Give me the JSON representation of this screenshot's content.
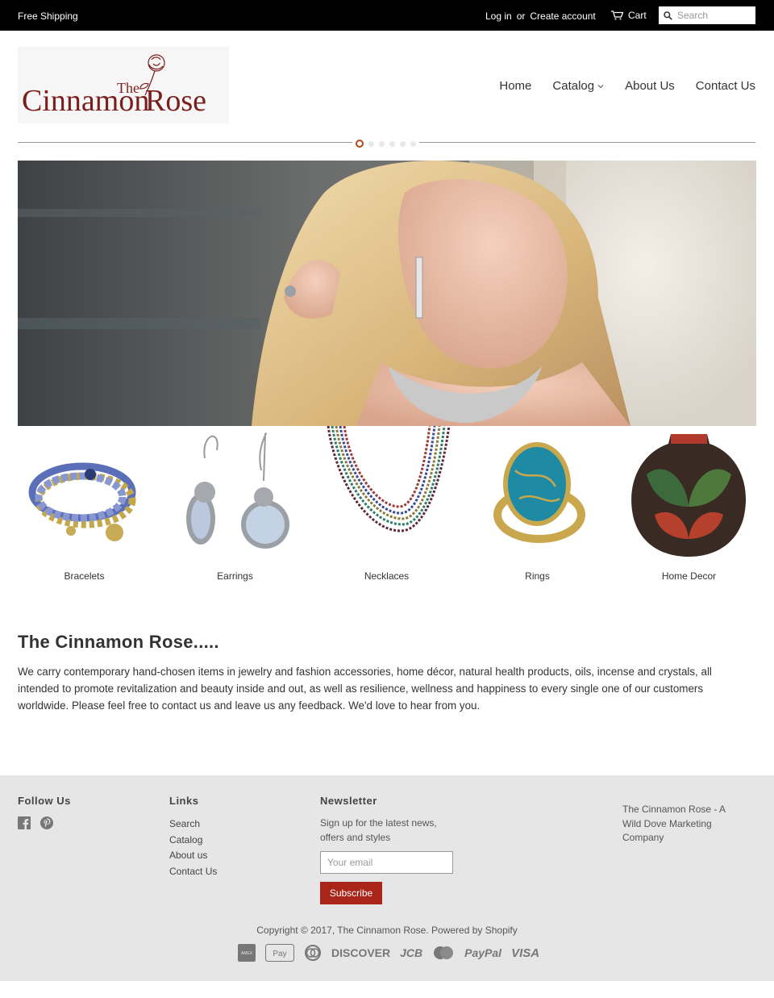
{
  "topbar": {
    "shipping": "Free Shipping",
    "login": "Log in",
    "or": "or",
    "create_account": "Create account",
    "cart": "Cart",
    "search_placeholder": "Search"
  },
  "logo": {
    "text": "The Cinnamon Rose",
    "the": "The",
    "cinnamon": "Cinnamon",
    "rose": "Rose"
  },
  "nav": {
    "home": "Home",
    "catalog": "Catalog",
    "about": "About Us",
    "contact": "Contact Us"
  },
  "slider": {
    "slide_count": 6,
    "active_slide": 1
  },
  "categories": [
    {
      "label": "Bracelets",
      "icon": "bracelet-image"
    },
    {
      "label": "Earrings",
      "icon": "earrings-image"
    },
    {
      "label": "Necklaces",
      "icon": "necklace-image"
    },
    {
      "label": "Rings",
      "icon": "ring-image"
    },
    {
      "label": "Home Decor",
      "icon": "vase-image"
    }
  ],
  "about": {
    "title": "The Cinnamon Rose.....",
    "text": "We carry contemporary hand-chosen items in jewelry and fashion accessories, home décor, natural health products, oils, incense and crystals, all intended to promote revitalization and beauty inside and out, as well as resilience, wellness and happiness to every single one of our customers worldwide. Please feel free to contact us and leave us any feedback. We'd love to hear from you."
  },
  "footer": {
    "follow_title": "Follow Us",
    "links_title": "Links",
    "links": [
      "Search",
      "Catalog",
      "About us",
      "Contact Us"
    ],
    "newsletter_title": "Newsletter",
    "newsletter_text": "Sign up for the latest news, offers and styles",
    "email_placeholder": "Your email",
    "subscribe": "Subscribe",
    "company": "The Cinnamon Rose - A Wild Dove Marketing Company",
    "copyright_prefix": "Copyright © 2017,",
    "copyright_store": "The Cinnamon Rose",
    "powered_by": "Powered by Shopify",
    "payments": [
      "American Express",
      "Apple Pay",
      "Diners Club",
      "DISCOVER",
      "JCB",
      "Master Card",
      "PayPal",
      "VISA"
    ]
  },
  "colors": {
    "accent": "#a92419",
    "topbar": "#000000",
    "footer_bg": "#e6e6e6",
    "logo_brand": "#7a1e1c"
  }
}
